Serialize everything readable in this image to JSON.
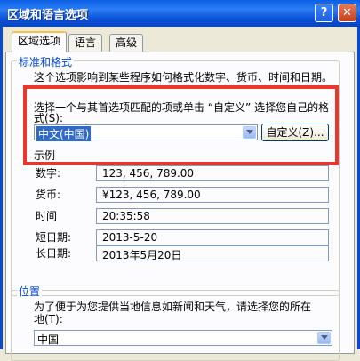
{
  "window": {
    "title": "区域和语言选项",
    "help_glyph": "?",
    "close_glyph": "✕"
  },
  "tabs": [
    {
      "label": "区域选项",
      "active": true
    },
    {
      "label": "语言",
      "active": false
    },
    {
      "label": "高级",
      "active": false
    }
  ],
  "standards": {
    "group_label": "标准和格式",
    "description": "这个选项影响到某些程序如何格式化数字、货币、时间和日期。",
    "prompt_line1": "选择一个与其首选项匹配的项或单击 “自定义” 选择您自己的格",
    "prompt_line2": "式(S):",
    "locale_value": "中文(中国)",
    "customize_label": "自定义(Z)...",
    "sample_label": "示例",
    "samples": [
      {
        "label": "数字:",
        "value": "123, 456, 789.00"
      },
      {
        "label": "货币:",
        "value": "¥123, 456, 789.00"
      },
      {
        "label": "时间",
        "value": "20:35:58"
      },
      {
        "label": "短日期:",
        "value": "2013-5-20"
      },
      {
        "label": "长日期:",
        "value": "2013年5月20日"
      }
    ]
  },
  "location": {
    "group_label": "位置",
    "description_line1": "为了便于为您提供当地信息如新闻和天气，请选择您的所在",
    "description_line2": "地(T):",
    "value": "中国"
  },
  "colors": {
    "highlight": "#e8372f",
    "titlebar": "#0a5fe3",
    "group_label": "#0046d5"
  }
}
